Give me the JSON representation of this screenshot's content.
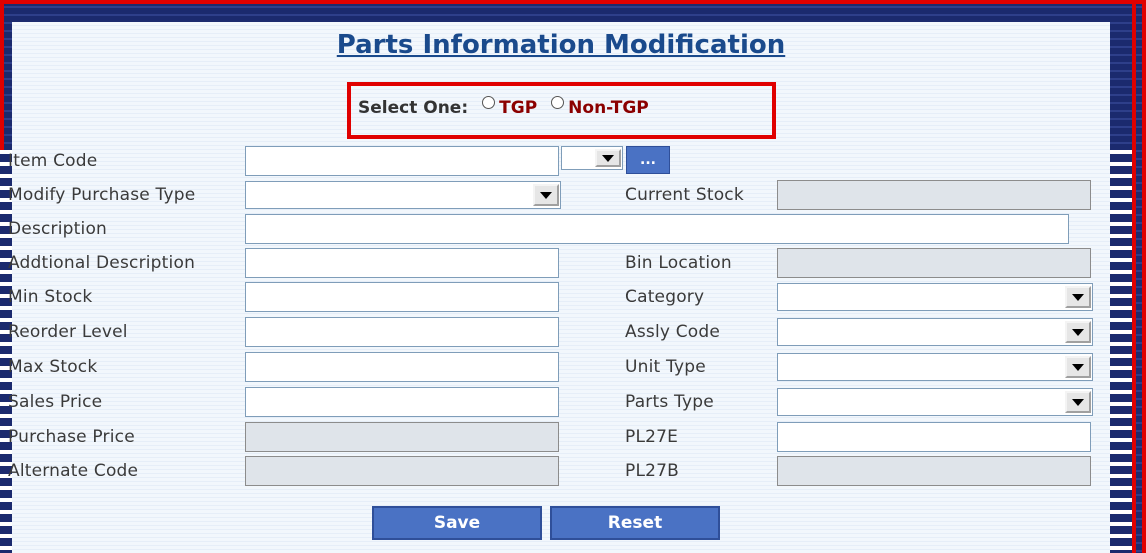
{
  "page": {
    "title": "Parts Information Modification"
  },
  "product_select": {
    "label": "Select One:",
    "options": [
      "TGP",
      "Non-TGP"
    ]
  },
  "left_fields": {
    "item_code": "Item Code",
    "modify_purchase_type": "Modify Purchase Type",
    "description": "Description",
    "additional_description": "Addtional Description",
    "min_stock": "Min Stock",
    "reorder_level": "Reorder Level",
    "max_stock": "Max Stock",
    "sales_price": "Sales Price",
    "purchase_price": "Purchase Price",
    "alternate_code": "Alternate Code"
  },
  "right_fields": {
    "current_stock": "Current Stock",
    "bin_location": "Bin Location",
    "category": "Category",
    "assly_code": "Assly Code",
    "unit_type": "Unit Type",
    "parts_type": "Parts Type",
    "pl27e": "PL27E",
    "pl27b": "PL27B"
  },
  "buttons": {
    "lookup": "...",
    "save": "Save",
    "reset": "Reset"
  },
  "colors": {
    "accent_red": "#e00000",
    "title_blue": "#1a4a8c",
    "button_blue": "#4a72c4",
    "background_navy": "#1b2a6e"
  }
}
